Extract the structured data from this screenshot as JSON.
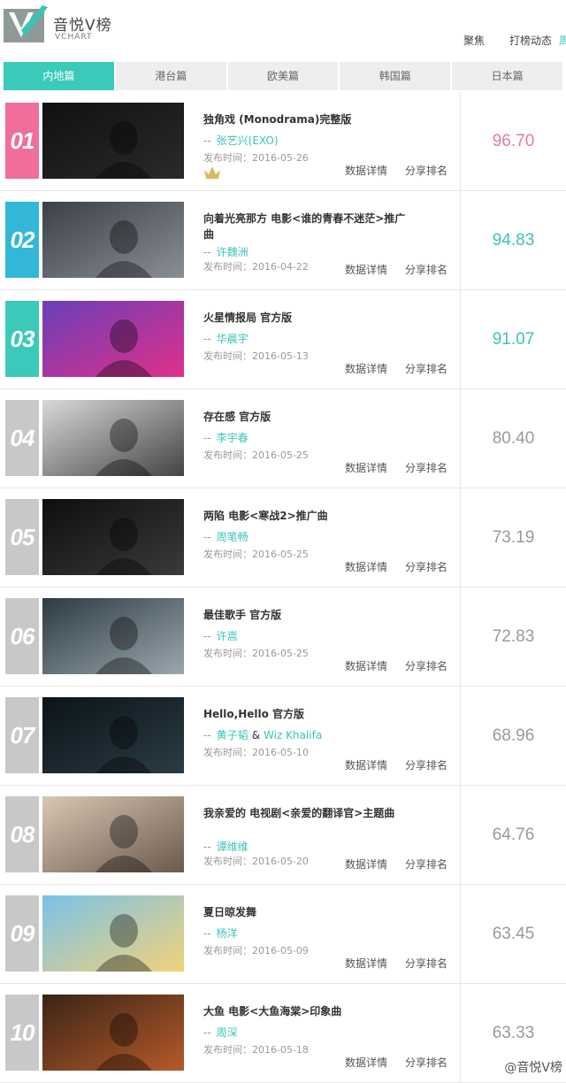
{
  "brand": {
    "name_cn": "音悦V榜",
    "name_en": "VCHART",
    "accent": "#3bc4b7"
  },
  "nav": [
    {
      "label": "聚焦",
      "active": false
    },
    {
      "label": "打榜动态",
      "active": false
    },
    {
      "label": "周",
      "active": true
    }
  ],
  "tabs": [
    {
      "label": "内地篇",
      "active": true
    },
    {
      "label": "港台篇",
      "active": false
    },
    {
      "label": "欧美篇",
      "active": false
    },
    {
      "label": "韩国篇",
      "active": false
    },
    {
      "label": "日本篇",
      "active": false
    }
  ],
  "actions": {
    "detail": "数据详情",
    "share": "分享排名"
  },
  "date_prefix": "发布时间：",
  "rows": [
    {
      "rank": "01",
      "rank_color": "#f06d9c",
      "title": "独角戏 (Monodrama)完整版",
      "artists": [
        "张艺兴(EXO)"
      ],
      "date": "2016-05-26",
      "score": "96.70",
      "score_color": "#e57a98",
      "crown": true
    },
    {
      "rank": "02",
      "rank_color": "#33b7d8",
      "title": "向着光亮那方 电影<谁的青春不迷茫>推广曲",
      "artists": [
        "许魏洲"
      ],
      "date": "2016-04-22",
      "score": "94.83",
      "score_color": "#3bc4b7"
    },
    {
      "rank": "03",
      "rank_color": "#3bc9b9",
      "title": "火星情报局 官方版",
      "artists": [
        "华晨宇"
      ],
      "date": "2016-05-13",
      "score": "91.07",
      "score_color": "#3bc4b7"
    },
    {
      "rank": "04",
      "rank_color": "#c8c8c8",
      "title": "存在感 官方版",
      "artists": [
        "李宇春"
      ],
      "date": "2016-05-25",
      "score": "80.40",
      "score_color": "#999999"
    },
    {
      "rank": "05",
      "rank_color": "#c8c8c8",
      "title": "两陷 电影<寒战2>推广曲",
      "artists": [
        "周笔畅"
      ],
      "date": "2016-05-25",
      "score": "73.19",
      "score_color": "#999999"
    },
    {
      "rank": "06",
      "rank_color": "#c8c8c8",
      "title": "最佳歌手 官方版",
      "artists": [
        "许嵩"
      ],
      "date": "2016-05-25",
      "score": "72.83",
      "score_color": "#999999"
    },
    {
      "rank": "07",
      "rank_color": "#c8c8c8",
      "title": "Hello,Hello 官方版",
      "artists": [
        "黄子韬",
        "Wiz Khalifa"
      ],
      "date": "2016-05-10",
      "score": "68.96",
      "score_color": "#999999"
    },
    {
      "rank": "08",
      "rank_color": "#c8c8c8",
      "title": "我亲爱的 电视剧<亲爱的翻译官>主题曲",
      "artists": [
        "谭维维"
      ],
      "date": "2016-05-20",
      "score": "64.76",
      "score_color": "#999999"
    },
    {
      "rank": "09",
      "rank_color": "#c8c8c8",
      "title": "夏日晾发舞",
      "artists": [
        "杨洋"
      ],
      "date": "2016-05-09",
      "score": "63.45",
      "score_color": "#999999"
    },
    {
      "rank": "10",
      "rank_color": "#c8c8c8",
      "title": "大鱼 电影<大鱼海棠>印象曲",
      "artists": [
        "周深"
      ],
      "date": "2016-05-18",
      "score": "63.33",
      "score_color": "#999999"
    }
  ],
  "watermark": "@音悦V榜"
}
